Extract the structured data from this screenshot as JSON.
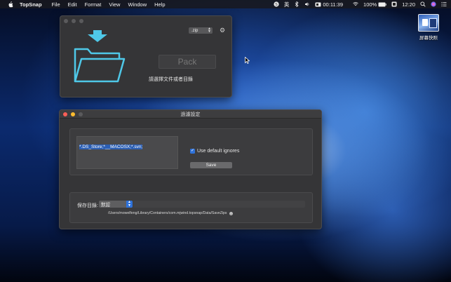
{
  "menubar": {
    "app_name": "TopSnap",
    "menus": [
      "File",
      "Edit",
      "Format",
      "View",
      "Window",
      "Help"
    ],
    "input_method": "英",
    "timer": "00:11:39",
    "battery": "100%",
    "clock": "12:20"
  },
  "desktop": {
    "icon_label": "屏幕快照"
  },
  "pack_window": {
    "format_value": ".zip",
    "pack_label": "Pack",
    "prompt": "請選擇文件或者目錄"
  },
  "filter_window": {
    "title": "過濾設定",
    "ignores_text": "*.DS_Store;*__MACOSX;*.svn;",
    "use_default_label": "Use default ignores",
    "use_default_checked": true,
    "save_label": "Save",
    "save_dir_label": "保存目錄:",
    "save_dir_value": "默認",
    "save_path": "/Users/mowelfeng/Library/Containers/com.mjwind.topsnap/Data/SaveZips"
  },
  "colors": {
    "accent": "#2f72d9",
    "folder": "#4fc8e8"
  }
}
